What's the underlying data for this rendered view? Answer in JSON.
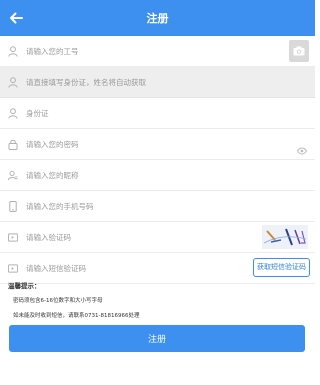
{
  "header": {
    "title": "注册"
  },
  "form": {
    "employee_id": {
      "placeholder": "请输入您的工号",
      "icon": "user-icon"
    },
    "id_card": {
      "placeholder": "请直接填写身份证，姓名将自动获取",
      "icon": "user-icon"
    },
    "id_label": {
      "placeholder": "身份证",
      "icon": "user-icon"
    },
    "password": {
      "placeholder": "请输入您的密码",
      "icon": "lock-icon"
    },
    "nickname": {
      "placeholder": "请输入您的昵称",
      "icon": "user-badge-icon"
    },
    "phone": {
      "placeholder": "请输入您的手机号码",
      "icon": "phone-icon"
    },
    "captcha": {
      "placeholder": "请输入验证码",
      "icon": "message-icon"
    },
    "sms_code": {
      "placeholder": "请输入短信验证码",
      "icon": "message-icon",
      "button_label": "获取短信验证码"
    }
  },
  "tips": {
    "title": "温馨提示：",
    "lines": [
      "密码须包含6-16位数字和大小写字母",
      "如未能及时收到短信，请联系0731-81816966处理"
    ]
  },
  "submit_label": "注册",
  "colors": {
    "accent": "#3d8ff0",
    "icon": "#b0b0b0"
  }
}
